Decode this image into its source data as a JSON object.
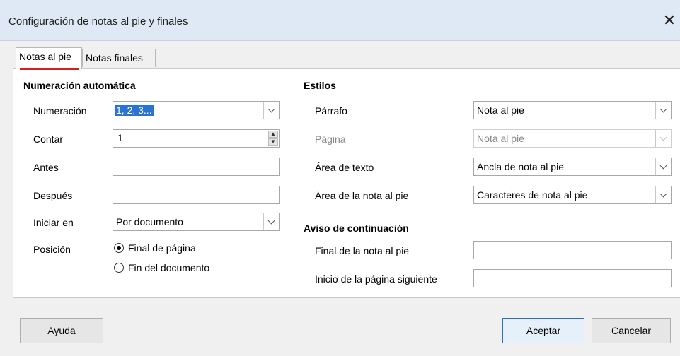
{
  "window": {
    "title": "Configuración de notas al pie y finales",
    "close_icon": "close-icon"
  },
  "tabs": [
    {
      "label": "Notas al pie",
      "active": true
    },
    {
      "label": "Notas finales",
      "active": false
    }
  ],
  "numeracion": {
    "heading": "Numeración automática",
    "numeracion_label": "Numeración",
    "numeracion_value": "1, 2, 3...",
    "contar_label": "Contar",
    "contar_value": "1",
    "antes_label": "Antes",
    "antes_value": "",
    "despues_label": "Después",
    "despues_value": "",
    "iniciar_label": "Iniciar en",
    "iniciar_value": "Por documento",
    "posicion_label": "Posición",
    "pos_final_pagina": "Final de página",
    "pos_fin_documento": "Fin del documento"
  },
  "estilos": {
    "heading": "Estilos",
    "parrafo_label": "Párrafo",
    "parrafo_value": "Nota al pie",
    "pagina_label": "Página",
    "pagina_value": "Nota al pie",
    "area_texto_label": "Área de texto",
    "area_texto_value": "Ancla de nota al pie",
    "area_nota_label": "Área de la nota al pie",
    "area_nota_value": "Caracteres de nota al pie"
  },
  "aviso": {
    "heading": "Aviso de continuación",
    "final_label": "Final de la nota al pie",
    "final_value": "",
    "inicio_label": "Inicio de la página siguiente",
    "inicio_value": ""
  },
  "buttons": {
    "ayuda": "Ayuda",
    "aceptar": "Aceptar",
    "cancelar": "Cancelar"
  },
  "colors": {
    "accent": "#2a73d1",
    "tab_underline": "#d21f1f"
  }
}
